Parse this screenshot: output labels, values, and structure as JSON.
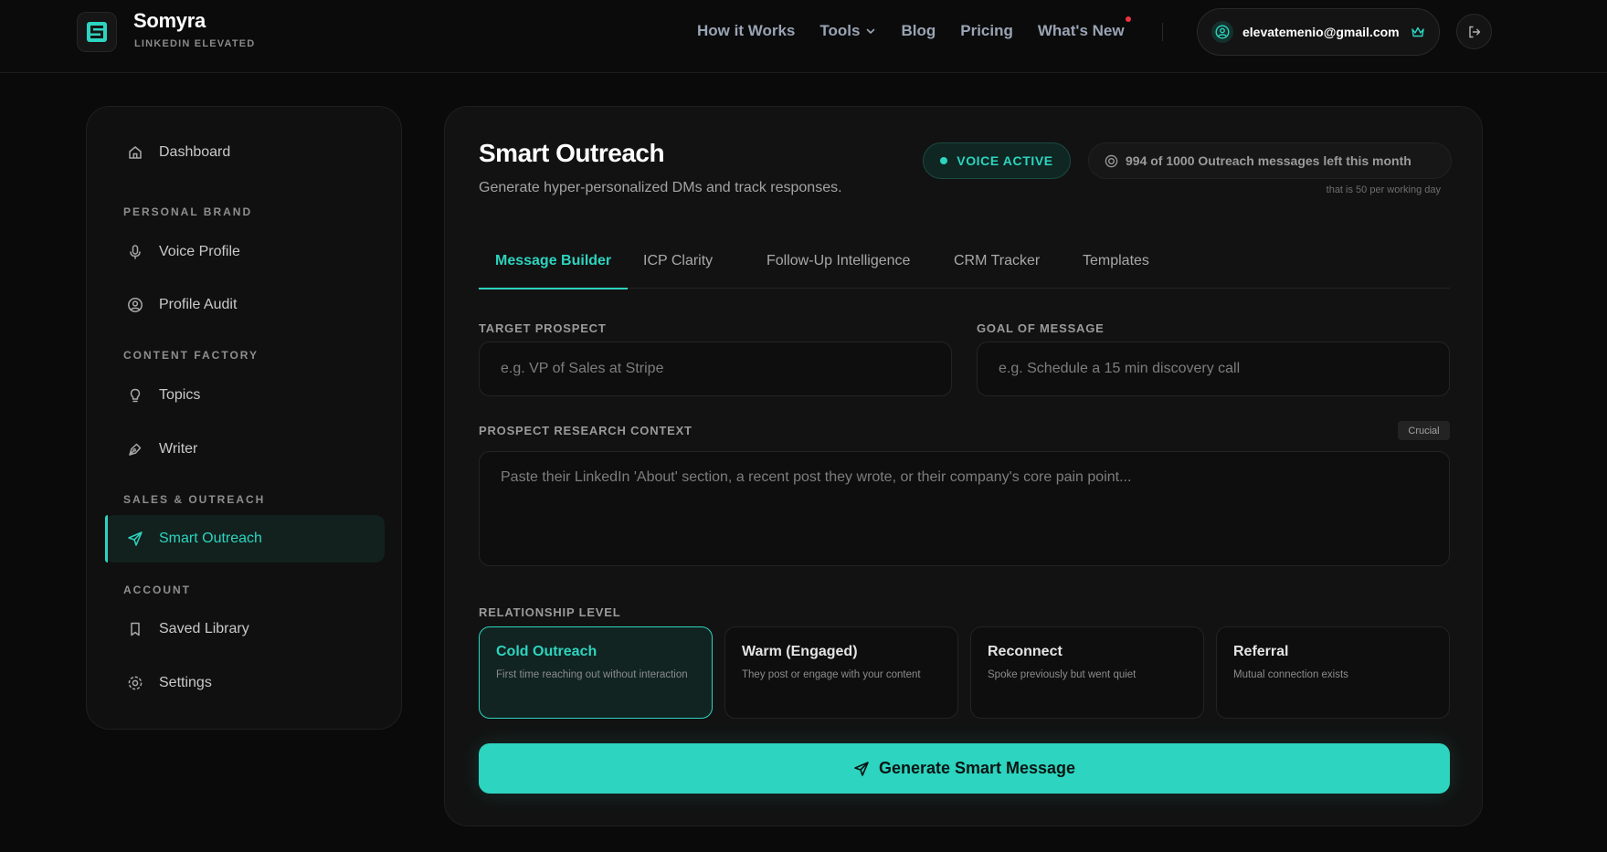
{
  "brand": {
    "name": "Somyra",
    "tagline": "LINKEDIN ELEVATED"
  },
  "nav": {
    "items": [
      {
        "label": "How it Works"
      },
      {
        "label": "Tools"
      },
      {
        "label": "Blog"
      },
      {
        "label": "Pricing"
      },
      {
        "label": "What's New"
      }
    ]
  },
  "user": {
    "email": "elevatemenio@gmail.com"
  },
  "sidebar": {
    "dashboard": "Dashboard",
    "sections": {
      "personal_brand": "PERSONAL BRAND",
      "content_factory": "CONTENT FACTORY",
      "sales_outreach": "SALES & OUTREACH",
      "account": "ACCOUNT"
    },
    "items": {
      "voice_profile": "Voice Profile",
      "profile_audit": "Profile Audit",
      "topics": "Topics",
      "writer": "Writer",
      "smart_outreach": "Smart Outreach",
      "saved_library": "Saved Library",
      "settings": "Settings"
    },
    "active": "Smart Outreach"
  },
  "main": {
    "title": "Smart Outreach",
    "subtitle": "Generate hyper-personalized DMs and track responses.",
    "voice_badge": "VOICE ACTIVE",
    "quota": "994 of 1000 Outreach messages left this month",
    "quota_note": "that is 50 per working day",
    "tabs": [
      {
        "label": "Message Builder"
      },
      {
        "label": "ICP Clarity"
      },
      {
        "label": "Follow-Up Intelligence"
      },
      {
        "label": "CRM Tracker"
      },
      {
        "label": "Templates"
      }
    ],
    "active_tab": "Message Builder",
    "form": {
      "target_label": "TARGET PROSPECT",
      "target_placeholder": "e.g. VP of Sales at Stripe",
      "target_value": "",
      "goal_label": "GOAL OF MESSAGE",
      "goal_placeholder": "e.g. Schedule a 15 min discovery call",
      "goal_value": "",
      "context_label": "PROSPECT RESEARCH CONTEXT",
      "context_badge": "Crucial",
      "context_placeholder": "Paste their LinkedIn 'About' section, a recent post they wrote, or their company's core pain point...",
      "relationship_label": "RELATIONSHIP LEVEL",
      "relationships": [
        {
          "title": "Cold Outreach",
          "desc": "First time reaching out without interaction",
          "selected": true
        },
        {
          "title": "Warm (Engaged)",
          "desc": "They post or engage with your content",
          "selected": false
        },
        {
          "title": "Reconnect",
          "desc": "Spoke previously but went quiet",
          "selected": false
        },
        {
          "title": "Referral",
          "desc": "Mutual connection exists",
          "selected": false
        }
      ],
      "generate_label": "Generate Smart Message"
    }
  },
  "colors": {
    "accent": "#2dd4bf",
    "background": "#0a0a0a",
    "card": "#121212",
    "notification": "#ef3340"
  }
}
